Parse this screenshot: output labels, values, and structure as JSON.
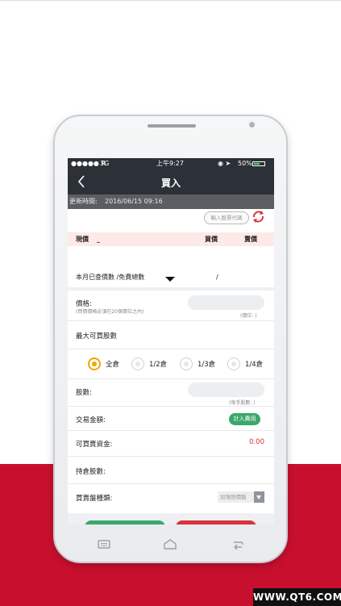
{
  "status_bar": {
    "carrier": "●●●●● R",
    "network": "3G",
    "time": "上午9:27",
    "battery": "50%"
  },
  "nav": {
    "title": "買入"
  },
  "update": {
    "label": "更新時間:",
    "value": "2016/06/15 09:16"
  },
  "stock_input": {
    "placeholder": "輸入股票代碼"
  },
  "quote_header": {
    "current_label": "現價",
    "current_value": "_",
    "bid_label": "買價",
    "ask_label": "賣價"
  },
  "month_row": {
    "label": "本月已查價數 /免費總數",
    "divider": "/"
  },
  "form": {
    "price_label": "價格:",
    "price_hint": "(買價價格必須在20個價位之內)",
    "price_unit_hint": "(價位:  )",
    "max_shares_label": "最大可買股數",
    "radio_options": [
      "全倉",
      "1/2倉",
      "1/3倉",
      "1/4倉"
    ],
    "selected_option": "全倉",
    "shares_label": "股數:",
    "shares_hint": "(每手股數:  )",
    "trade_amount_label": "交易金額:",
    "fee_button": "計入費用",
    "available_cash_label": "可買賣資金:",
    "available_cash_value": "0.00",
    "holding_label": "持倉股數:",
    "order_type_label": "買賣盤種類:",
    "order_type_value": "加強限價盤"
  },
  "colors": {
    "accent_red": "#c8102e",
    "green": "#3aa86b",
    "radio_selected": "#f0a500",
    "navbar": "#2c3138"
  },
  "watermark": "WWW.QT6.COM"
}
